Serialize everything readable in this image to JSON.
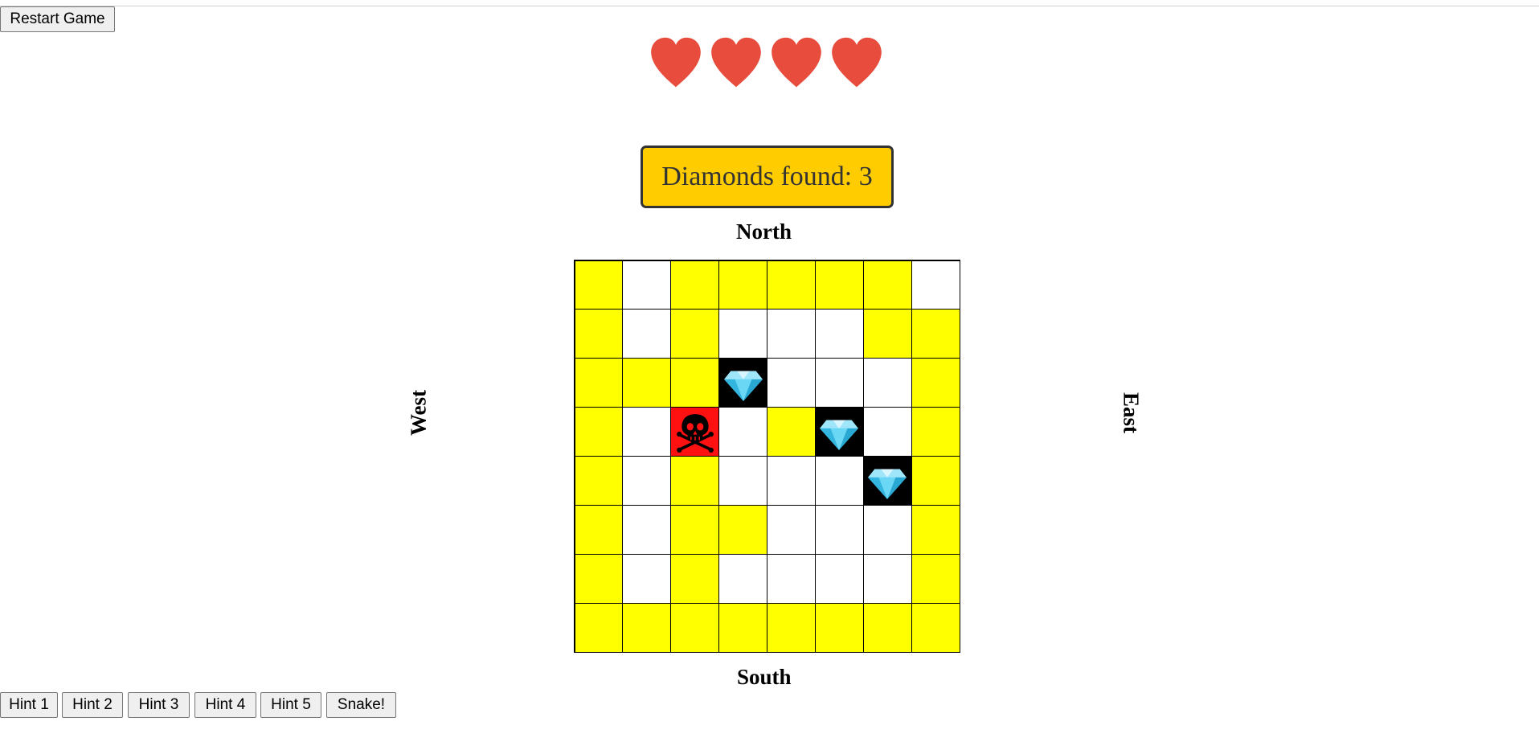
{
  "controls": {
    "restart_label": "Restart Game",
    "hints": [
      "Hint 1",
      "Hint 2",
      "Hint 3",
      "Hint 4",
      "Hint 5"
    ],
    "snake_label": "Snake!"
  },
  "lives": {
    "count": 4,
    "icon": "heart-icon",
    "color": "#e74c3c"
  },
  "score": {
    "text": "Diamonds found: 3",
    "background": "#ffcc00"
  },
  "compass": {
    "north": "North",
    "south": "South",
    "west": "West",
    "east": "East"
  },
  "board": {
    "rows": 8,
    "cols": 8,
    "legend": {
      "Y": "yellow-revealed",
      "W": "unrevealed",
      "D": "diamond",
      "M": "skull-mine"
    },
    "colors": {
      "yellow": "#ffff00",
      "white": "#ffffff",
      "diamond": "#000000",
      "mine": "#ff1111"
    },
    "cells": [
      [
        "Y",
        "W",
        "Y",
        "Y",
        "Y",
        "Y",
        "Y",
        "W"
      ],
      [
        "Y",
        "W",
        "Y",
        "W",
        "W",
        "W",
        "Y",
        "Y"
      ],
      [
        "Y",
        "Y",
        "Y",
        "D",
        "W",
        "W",
        "W",
        "Y"
      ],
      [
        "Y",
        "W",
        "M",
        "W",
        "Y",
        "D",
        "W",
        "Y"
      ],
      [
        "Y",
        "W",
        "Y",
        "W",
        "W",
        "W",
        "D",
        "Y"
      ],
      [
        "Y",
        "W",
        "Y",
        "Y",
        "W",
        "W",
        "W",
        "Y"
      ],
      [
        "Y",
        "W",
        "Y",
        "W",
        "W",
        "W",
        "W",
        "Y"
      ],
      [
        "Y",
        "Y",
        "Y",
        "Y",
        "Y",
        "Y",
        "Y",
        "Y"
      ]
    ]
  }
}
